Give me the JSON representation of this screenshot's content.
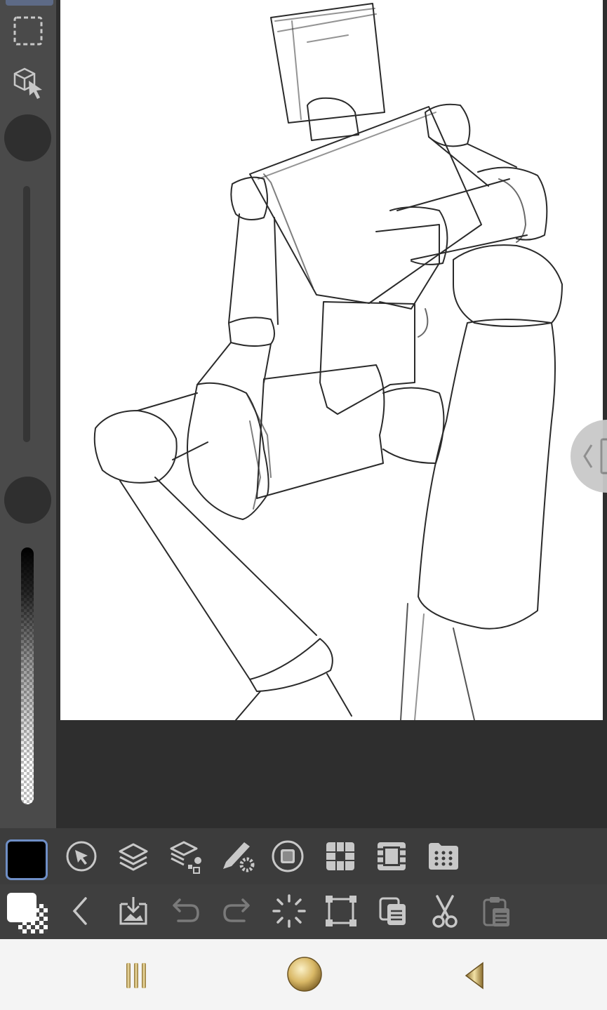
{
  "app": {
    "accent": "#6f8fc7",
    "canvas_bg": "#ffffff",
    "panel_bg": "#4a4a4a"
  },
  "left_toolbar": {
    "tools": [
      {
        "name": "selection-tool",
        "icon": "dashed-rect-icon"
      },
      {
        "name": "object-tool",
        "icon": "cube-cursor-icon"
      }
    ],
    "brush_size_knob": "knob",
    "opacity_knob": "knob"
  },
  "bottom_toolbar_1": {
    "items": [
      "sub-tool",
      "layer",
      "layer-property",
      "tool-property",
      "color",
      "navigator",
      "animation",
      "material"
    ]
  },
  "bottom_toolbar_2": {
    "items": [
      "back",
      "save",
      "undo",
      "redo",
      "selection",
      "transform",
      "copy",
      "cut",
      "paste"
    ]
  },
  "colors": {
    "main": "#000000",
    "sub": "#ffffff"
  },
  "navbar": {
    "items": [
      "recent-apps",
      "home",
      "back"
    ]
  }
}
